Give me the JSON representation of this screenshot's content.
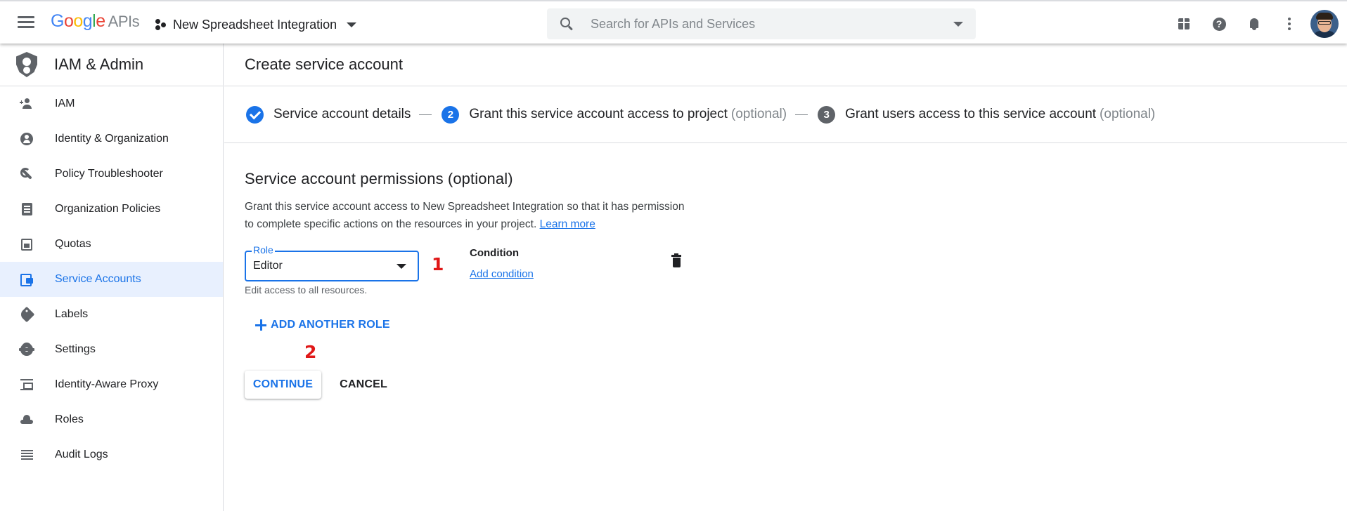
{
  "header": {
    "logo_google": "Google",
    "logo_apis": "APIs",
    "project_name": "New Spreadsheet Integration",
    "search_placeholder": "Search for APIs and Services",
    "icons": [
      "menu-icon",
      "project-icon",
      "search-icon",
      "gift-icon",
      "help-icon",
      "notifications-icon",
      "more-vert-icon",
      "avatar"
    ]
  },
  "sidebar": {
    "title": "IAM & Admin",
    "items": [
      {
        "label": "IAM",
        "icon": "person-add-icon"
      },
      {
        "label": "Identity & Organization",
        "icon": "account-circle-icon"
      },
      {
        "label": "Policy Troubleshooter",
        "icon": "wrench-icon"
      },
      {
        "label": "Organization Policies",
        "icon": "document-icon"
      },
      {
        "label": "Quotas",
        "icon": "quota-icon"
      },
      {
        "label": "Service Accounts",
        "icon": "service-account-icon",
        "active": true
      },
      {
        "label": "Labels",
        "icon": "label-icon"
      },
      {
        "label": "Settings",
        "icon": "gear-icon"
      },
      {
        "label": "Identity-Aware Proxy",
        "icon": "proxy-icon"
      },
      {
        "label": "Roles",
        "icon": "roles-icon"
      },
      {
        "label": "Audit Logs",
        "icon": "list-icon"
      }
    ]
  },
  "main": {
    "title": "Create service account",
    "steps": [
      {
        "number": "",
        "label": "Service account details",
        "optional": "",
        "state": "done"
      },
      {
        "number": "2",
        "label": "Grant this service account access to project",
        "optional": "(optional)",
        "state": "active"
      },
      {
        "number": "3",
        "label": "Grant users access to this service account",
        "optional": "(optional)",
        "state": "pending"
      }
    ],
    "section_title": "Service account permissions (optional)",
    "description": "Grant this service account access to New Spreadsheet Integration so that it has permission to complete specific actions on the resources in your project.",
    "learn_more": "Learn more",
    "role": {
      "label": "Role",
      "value": "Editor",
      "hint": "Edit access to all resources."
    },
    "condition": {
      "label": "Condition",
      "link": "Add condition"
    },
    "add_role_label": "ADD ANOTHER ROLE",
    "continue_label": "CONTINUE",
    "cancel_label": "CANCEL",
    "annotations": [
      "1",
      "2"
    ]
  },
  "colors": {
    "accent": "#1a73e8",
    "active_nav_bg": "#e8f0fe",
    "annotation": "#e01818"
  }
}
